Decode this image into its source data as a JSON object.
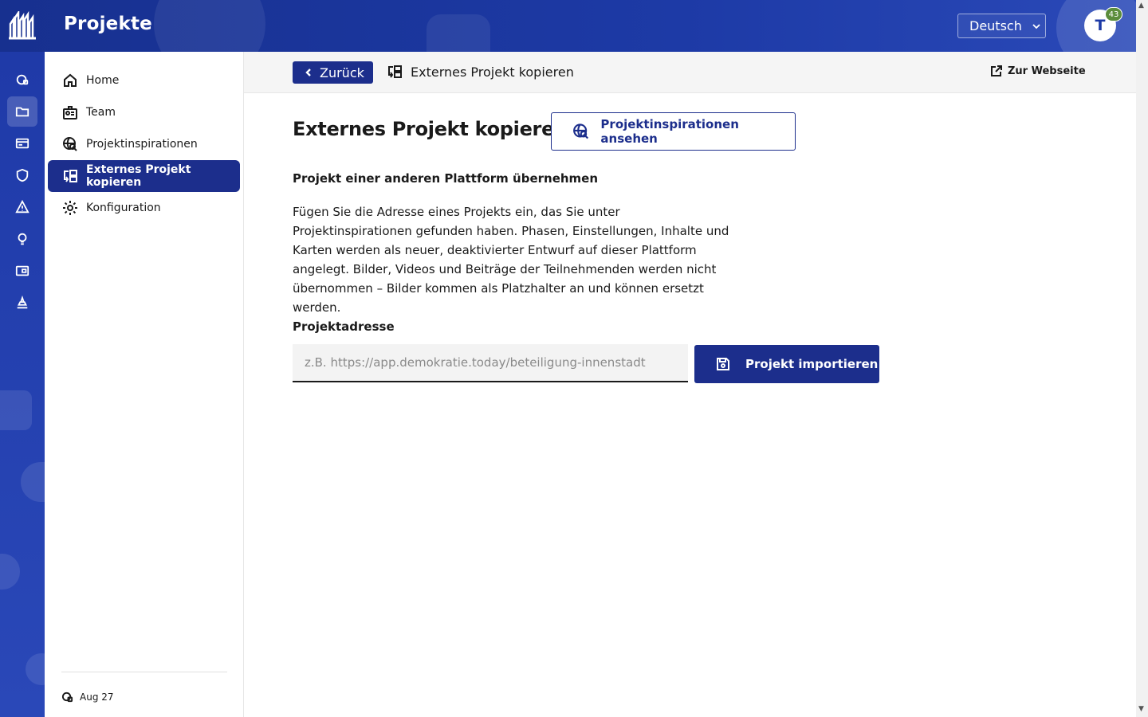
{
  "header": {
    "title": "Projekte",
    "language": "Deutsch",
    "user_initial": "T",
    "notification_count": "43"
  },
  "rail": {
    "icons": [
      "dashboard-icon",
      "folder-icon",
      "cards-icon",
      "shield-icon",
      "warning-icon",
      "lightbulb-icon",
      "wallet-icon",
      "stamp-icon"
    ],
    "active": "folder-icon"
  },
  "sidebar": {
    "items": [
      {
        "label": "Home",
        "icon": "home-icon"
      },
      {
        "label": "Team",
        "icon": "team-icon"
      },
      {
        "label": "Projektinspirationen",
        "icon": "globe-search-icon"
      },
      {
        "label": "Externes Projekt kopieren",
        "icon": "copy-external-icon",
        "active": true
      },
      {
        "label": "Konfiguration",
        "icon": "gear-icon"
      }
    ],
    "footer_date": "Aug 27"
  },
  "topbar": {
    "back_label": "Zurück",
    "breadcrumb": "Externes Projekt kopieren",
    "site_link": "Zur Webseite"
  },
  "main": {
    "title": "Externes Projekt kopieren",
    "inspire_button": "Projektinspirationen ansehen",
    "subheading": "Projekt einer anderen Plattform übernehmen",
    "description": "Fügen Sie die Adresse eines Projekts ein, das Sie unter Projektinspirationen gefunden haben. Phasen, Einstellungen, Inhalte und Karten werden als neuer, deaktivierter Entwurf auf dieser Plattform angelegt. Bilder, Videos und Beiträge der Teilnehmenden werden nicht übernommen – Bilder kommen als Platzhalter an und können ersetzt werden.",
    "field_label": "Projektadresse",
    "field_value": "",
    "field_placeholder": "z.B. https://app.demokratie.today/beteiligung-innenstadt",
    "import_button": "Projekt importieren"
  },
  "colors": {
    "primary": "#1c2e8c",
    "header": "#1d3aa6",
    "badge": "#5b8d3c"
  }
}
